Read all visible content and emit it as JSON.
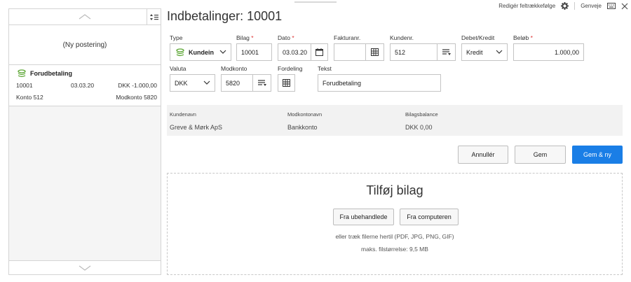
{
  "header": {
    "title": "Indbetalinger: 10001",
    "edit_order": "Redigér feltrækkefølge",
    "shortcuts": "Genveje"
  },
  "list": {
    "new_posting": "(Ny postering)",
    "entries": [
      {
        "title": "Forudbetaling",
        "voucher": "10001",
        "date": "03.03.20",
        "amount": "DKK -1.000,00",
        "account": "Konto 512",
        "offset": "Modkonto 5820"
      }
    ]
  },
  "form": {
    "type_label": "Type",
    "type_value": "Kundeind",
    "bilag_label": "Bilag",
    "bilag_value": "10001",
    "dato_label": "Dato",
    "dato_value": "03.03.20",
    "faktura_label": "Fakturanr.",
    "faktura_value": "",
    "kunde_label": "Kundenr.",
    "kunde_value": "512",
    "debet_label": "Debet/Kredit",
    "debet_value": "Kredit",
    "beloeb_label": "Beløb",
    "beloeb_value": "1.000,00",
    "valuta_label": "Valuta",
    "valuta_value": "DKK",
    "modkonto_label": "Modkonto",
    "modkonto_value": "5820",
    "fordeling_label": "Fordeling",
    "tekst_label": "Tekst",
    "tekst_value": "Forudbetaling",
    "required_mark": "*"
  },
  "info": {
    "kundenavn_label": "Kundenavn",
    "kundenavn_value": "Greve & Mørk ApS",
    "modkontonavn_label": "Modkontonavn",
    "modkontonavn_value": "Bankkonto",
    "balance_label": "Bilagsbalance",
    "balance_value": "DKK 0,00"
  },
  "actions": {
    "cancel": "Annullér",
    "save": "Gem",
    "save_new": "Gem & ny"
  },
  "attach": {
    "title": "Tilføj bilag",
    "from_unprocessed": "Fra ubehandlede",
    "from_computer": "Fra computeren",
    "hint": "eller træk filerne hertil (PDF, JPG, PNG, GIF)",
    "max_size": "maks. filstørrelse: 9,5 MB"
  },
  "colors": {
    "primary": "#1a7ee6",
    "required": "#d33333",
    "accent_green": "#5aa532"
  }
}
